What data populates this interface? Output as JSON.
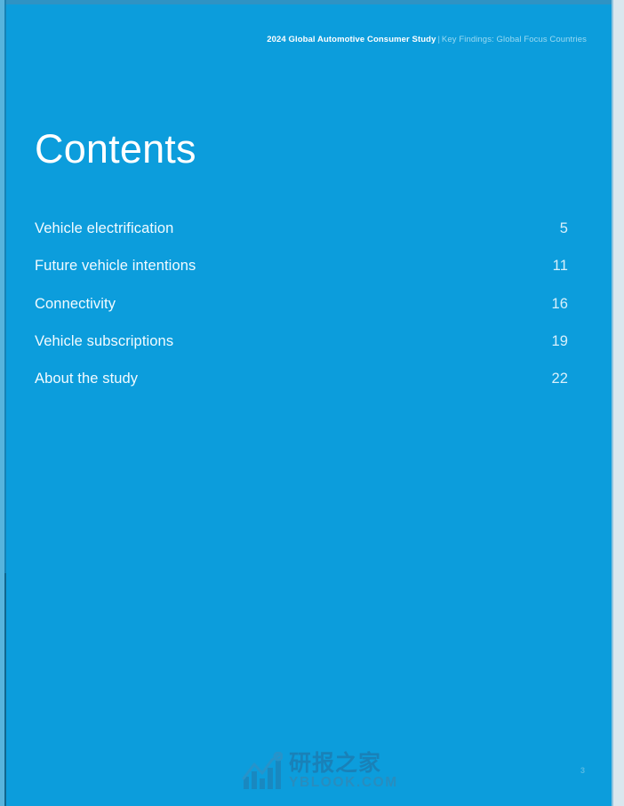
{
  "document": {
    "background_color": "#0c9ddc",
    "accent_color": "#ffffff"
  },
  "header": {
    "title": "2024 Global Automotive Consumer Study",
    "separator": "|",
    "subtitle": "Key Findings: Global Focus Countries"
  },
  "page_title": "Contents",
  "toc": {
    "entries": [
      {
        "label": "Vehicle electrification",
        "page": "5"
      },
      {
        "label": "Future vehicle intentions",
        "page": "11"
      },
      {
        "label": "Connectivity",
        "page": "16"
      },
      {
        "label": "Vehicle subscriptions",
        "page": "19"
      },
      {
        "label": "About the study",
        "page": "22"
      }
    ]
  },
  "footer": {
    "folio": "3"
  },
  "watermark": {
    "logo_icon": "bar-chart-trend-icon",
    "chinese_text": "研报之家",
    "site_text": "YBLOOK.COM",
    "color": "#1b7fb5"
  }
}
